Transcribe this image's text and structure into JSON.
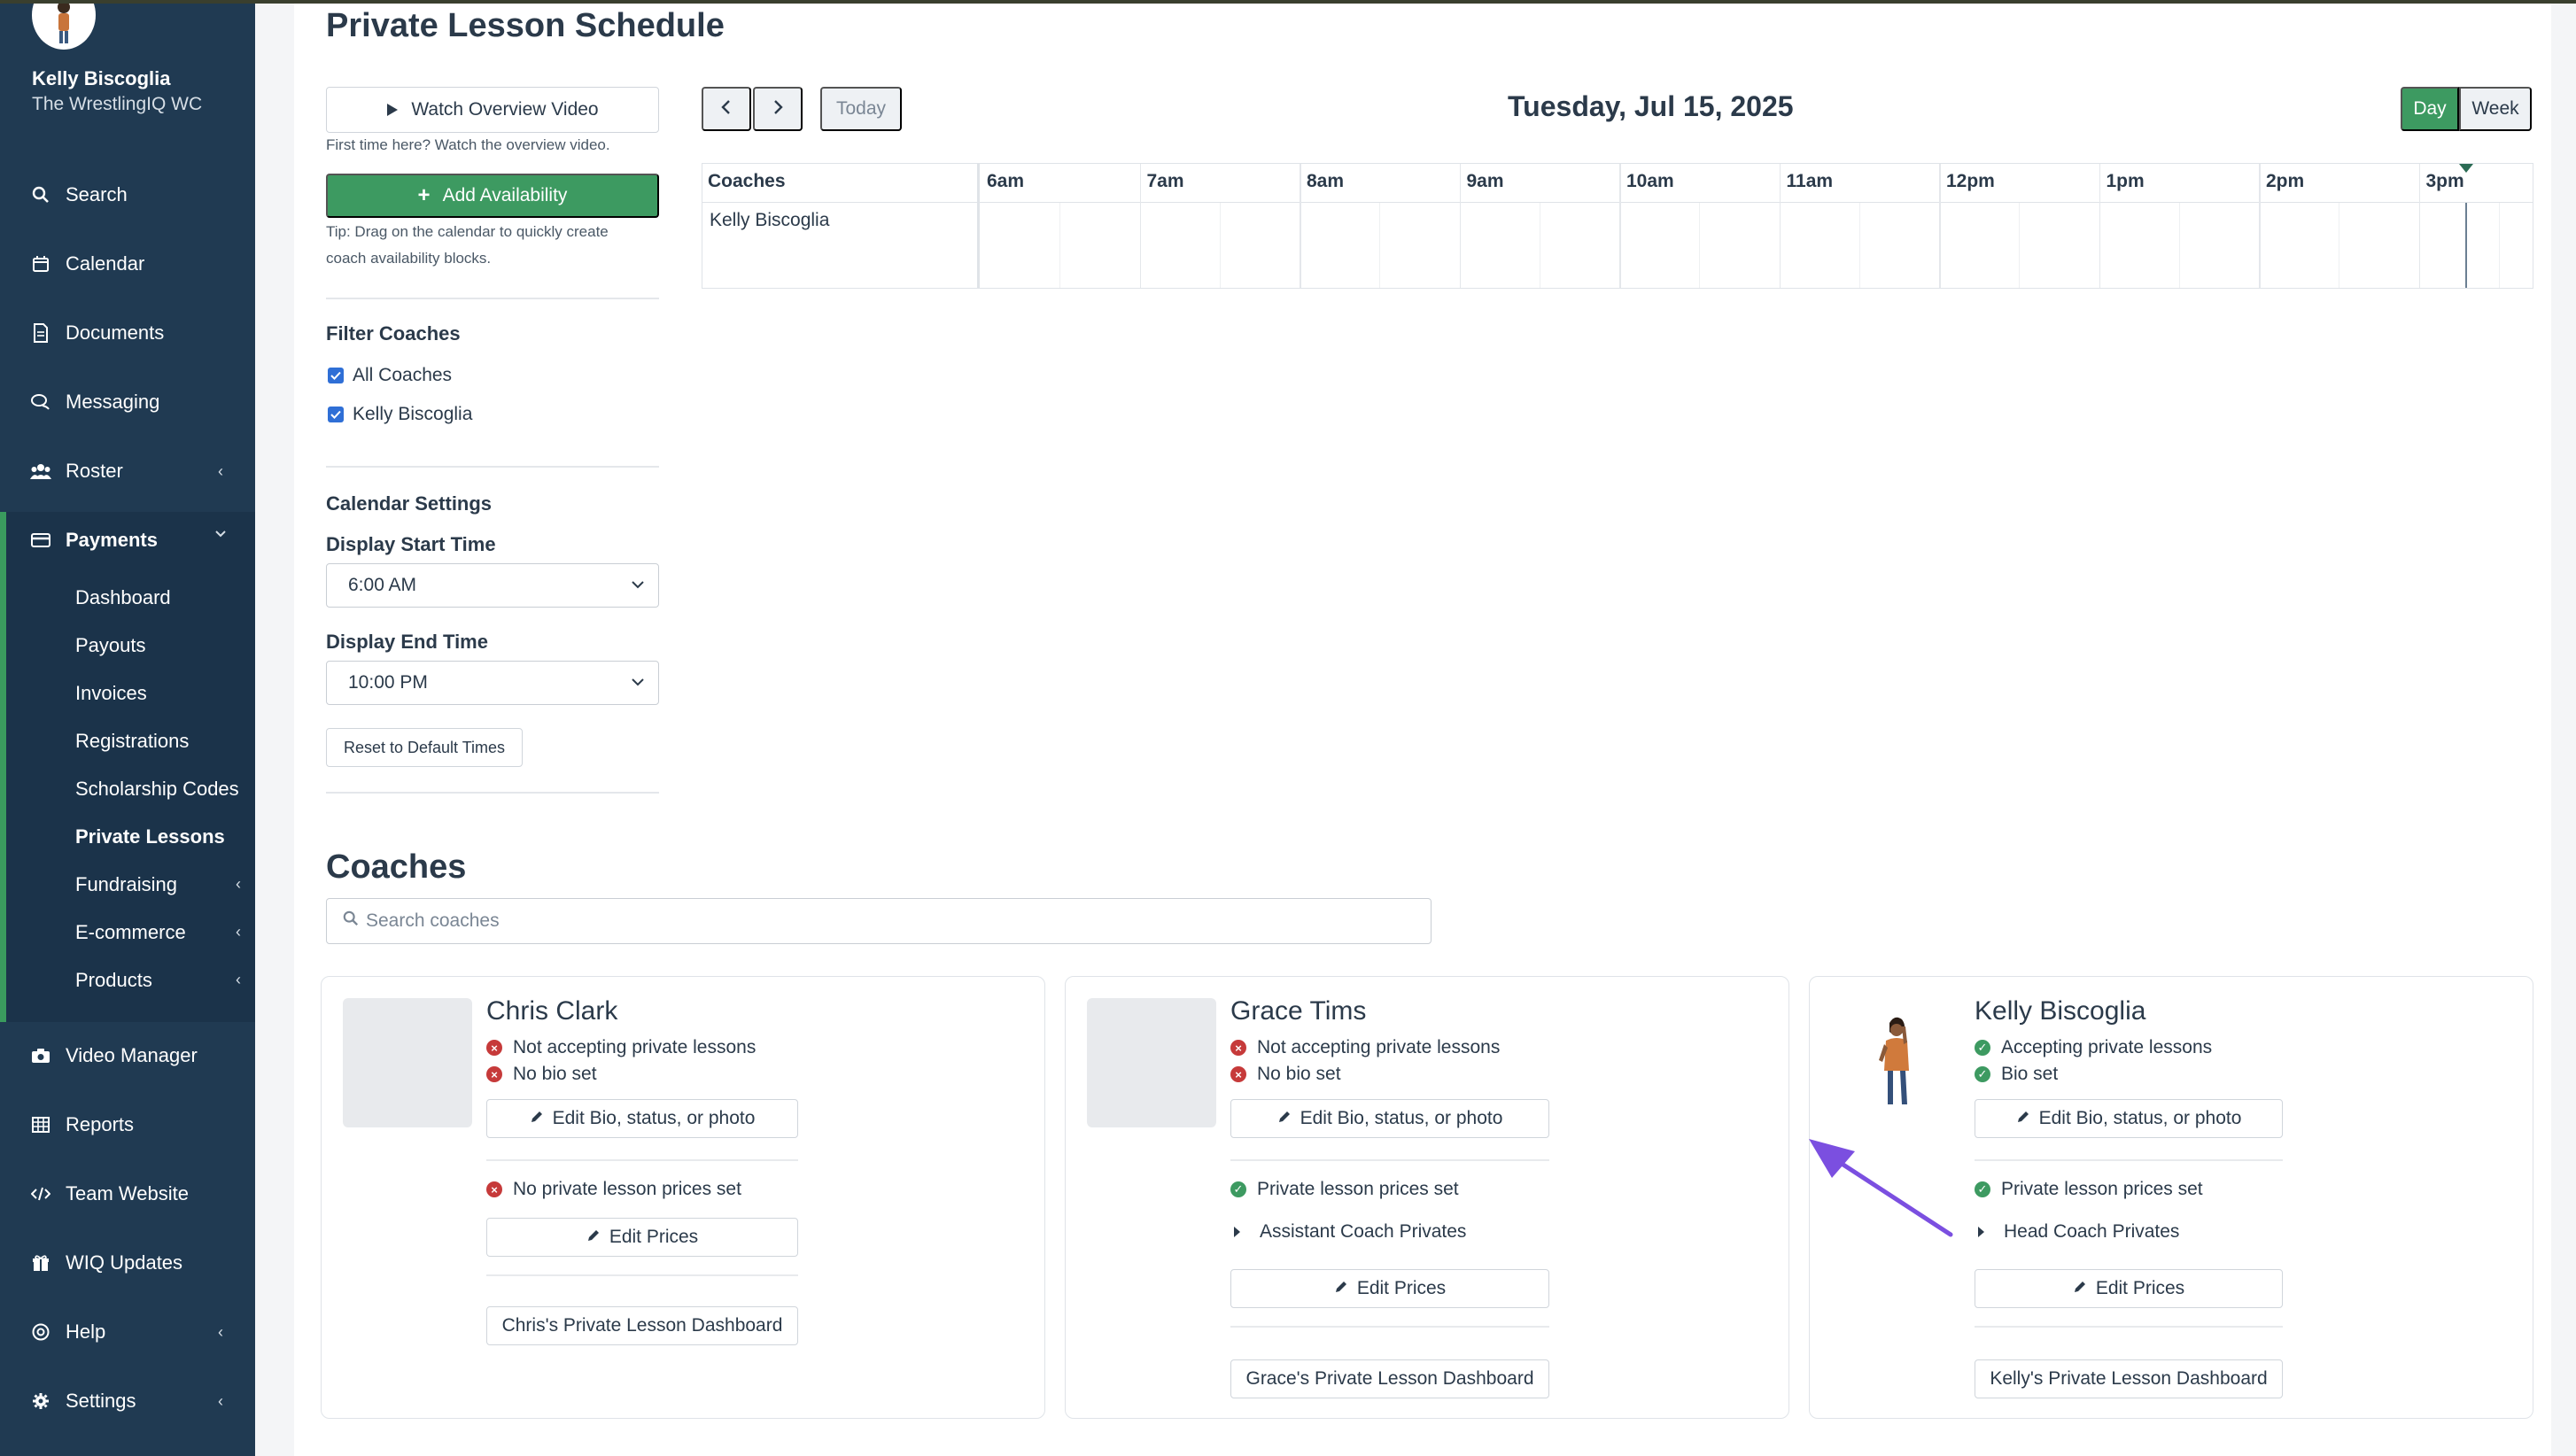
{
  "sidebar": {
    "user_name": "Kelly Biscoglia",
    "user_org": "The WrestlingIQ WC",
    "items": [
      {
        "label": "Search",
        "icon": "search-icon"
      },
      {
        "label": "Calendar",
        "icon": "calendar-icon"
      },
      {
        "label": "Documents",
        "icon": "document-icon"
      },
      {
        "label": "Messaging",
        "icon": "chat-icon"
      },
      {
        "label": "Roster",
        "icon": "users-icon",
        "chevron": "‹"
      },
      {
        "label": "Payments",
        "icon": "credit-card-icon",
        "chevron": "⌄"
      },
      {
        "label": "Video Manager",
        "icon": "camera-icon"
      },
      {
        "label": "Reports",
        "icon": "table-icon"
      },
      {
        "label": "Team Website",
        "icon": "code-icon"
      },
      {
        "label": "WIQ Updates",
        "icon": "gift-icon"
      },
      {
        "label": "Help",
        "icon": "globe-icon",
        "chevron": "‹"
      },
      {
        "label": "Settings",
        "icon": "gear-icon",
        "chevron": "‹"
      }
    ],
    "payments_sub": [
      {
        "label": "Dashboard"
      },
      {
        "label": "Payouts"
      },
      {
        "label": "Invoices"
      },
      {
        "label": "Registrations"
      },
      {
        "label": "Scholarship Codes"
      },
      {
        "label": "Private Lessons",
        "active": true
      },
      {
        "label": "Fundraising",
        "chevron": "‹"
      },
      {
        "label": "E-commerce",
        "chevron": "‹"
      },
      {
        "label": "Products",
        "chevron": "‹"
      }
    ]
  },
  "page": {
    "title": "Private Lesson Schedule",
    "watch_video_label": "Watch Overview Video",
    "watch_hint": "First time here? Watch the overview video.",
    "add_availability_label": "Add Availability",
    "tip_line1": "Tip: Drag on the calendar to quickly create",
    "tip_line2": "coach availability blocks.",
    "filter_title": "Filter Coaches",
    "filter_all": "All Coaches",
    "filter_coach": "Kelly Biscoglia",
    "calendar_settings_title": "Calendar Settings",
    "start_time_label": "Display Start Time",
    "start_time_value": "6:00 AM",
    "end_time_label": "Display End Time",
    "end_time_value": "10:00 PM",
    "reset_label": "Reset to Default Times"
  },
  "calendar": {
    "today_label": "Today",
    "date": "Tuesday, Jul 15, 2025",
    "view_day": "Day",
    "view_week": "Week",
    "coaches_header": "Coaches",
    "hours": [
      "6am",
      "7am",
      "8am",
      "9am",
      "10am",
      "11am",
      "12pm",
      "1pm",
      "2pm",
      "3pm"
    ],
    "rows": [
      "Kelly Biscoglia"
    ]
  },
  "coaches": {
    "title": "Coaches",
    "search_placeholder": "Search coaches",
    "cards": [
      {
        "name": "Chris Clark",
        "status1": "Not accepting private lessons",
        "status2": "No bio set",
        "edit_bio": "Edit Bio, status, or photo",
        "prices_status": "No private lesson prices set",
        "edit_prices": "Edit Prices",
        "dashboard": "Chris's Private Lesson Dashboard"
      },
      {
        "name": "Grace Tims",
        "status1": "Not accepting private lessons",
        "status2": "No bio set",
        "edit_bio": "Edit Bio, status, or photo",
        "prices_status": "Private lesson prices set",
        "price_group": "Assistant Coach Privates",
        "edit_prices": "Edit Prices",
        "dashboard": "Grace's Private Lesson Dashboard"
      },
      {
        "name": "Kelly Biscoglia",
        "status1": "Accepting private lessons",
        "status2": "Bio set",
        "edit_bio": "Edit Bio, status, or photo",
        "prices_status": "Private lesson prices set",
        "price_group": "Head Coach Privates",
        "edit_prices": "Edit Prices",
        "dashboard": "Kelly's Private Lesson Dashboard"
      }
    ]
  },
  "colors": {
    "sidebar_bg": "#203a52",
    "accent_green": "#3d9a61",
    "error_red": "#c63a3a",
    "annotation_arrow": "#7b4fe0"
  }
}
